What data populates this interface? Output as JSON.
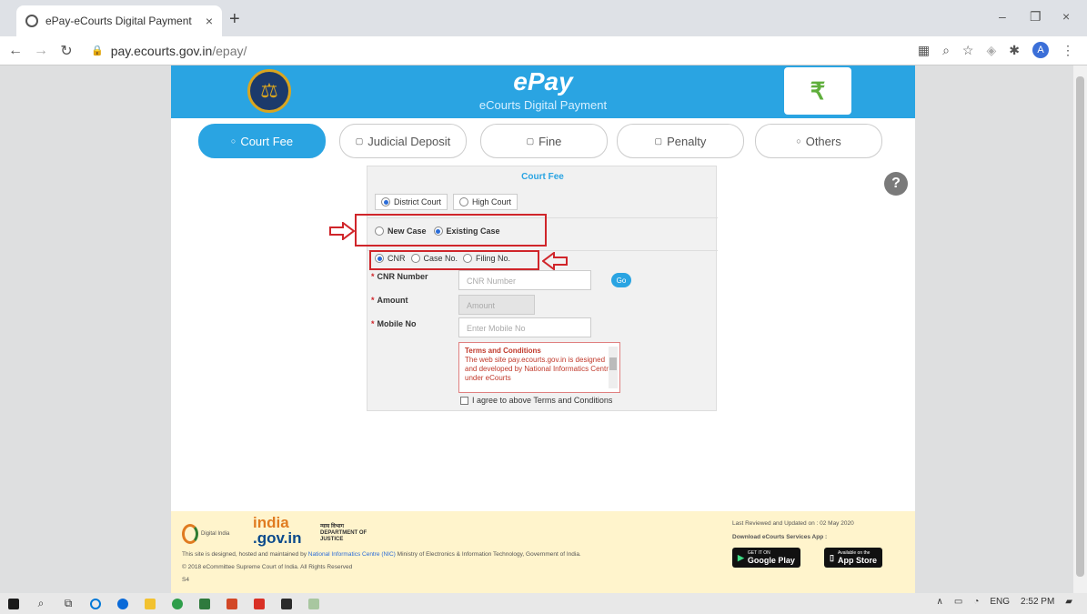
{
  "browser": {
    "tab_title": "ePay-eCourts Digital Payment",
    "tab_close": "×",
    "new_tab": "+",
    "url_host": "pay.ecourts.gov.in",
    "url_path": "/epay/",
    "win_min": "–",
    "win_max": "❐",
    "win_close": "×",
    "avatar_letter": "A"
  },
  "header": {
    "title": "ePay",
    "subtitle": "eCourts Digital Payment",
    "logo_symbol": "₹"
  },
  "payment_tabs": [
    {
      "label": "Court Fee",
      "active": true
    },
    {
      "label": "Judicial Deposit",
      "active": false
    },
    {
      "label": "Fine",
      "active": false
    },
    {
      "label": "Penalty",
      "active": false
    },
    {
      "label": "Others",
      "active": false
    }
  ],
  "form": {
    "title": "Court Fee",
    "court_options": [
      "District Court",
      "High Court"
    ],
    "case_options": [
      "New Case",
      "Existing Case"
    ],
    "search_options": [
      "CNR",
      "Case No.",
      "Filing No."
    ],
    "cnr_label": "CNR Number",
    "cnr_placeholder": "CNR Number",
    "go_label": "Go",
    "amount_label": "Amount",
    "amount_placeholder": "Amount",
    "mobile_label": "Mobile No",
    "mobile_placeholder": "Enter Mobile No",
    "required_mark": "*",
    "terms_title": "Terms and Conditions",
    "terms_text": "The web site pay.ecourts.gov.in is designed and developed by National Informatics Centre under eCourts",
    "agree_text": "I agree to above Terms and Conditions"
  },
  "help_symbol": "?",
  "footer": {
    "digital_india": "Digital India",
    "india_line1": "india",
    "india_line2": ".gov.in",
    "dept_hindi": "न्याय विभाग",
    "dept_line1": "DEPARTMENT OF",
    "dept_line2": "JUSTICE",
    "designed_prefix": "This site is designed, hosted and maintained by ",
    "designed_link": "National Informatics Centre (NIC)",
    "designed_suffix": " Ministry of Electronics & Information Technology, Government of India.",
    "copyright": "© 2018 eCommittee Supreme Court of India. All Rights Reserved",
    "code": "S4",
    "reviewed": "Last Reviewed and Updated on : 02 May 2020",
    "download": "Download eCourts Services App :",
    "gplay_small": "GET IT ON",
    "gplay": "Google Play",
    "appstore_small": "Available on the",
    "appstore": "App Store"
  },
  "taskbar": {
    "lang": "ENG",
    "time": "2:52 PM"
  }
}
